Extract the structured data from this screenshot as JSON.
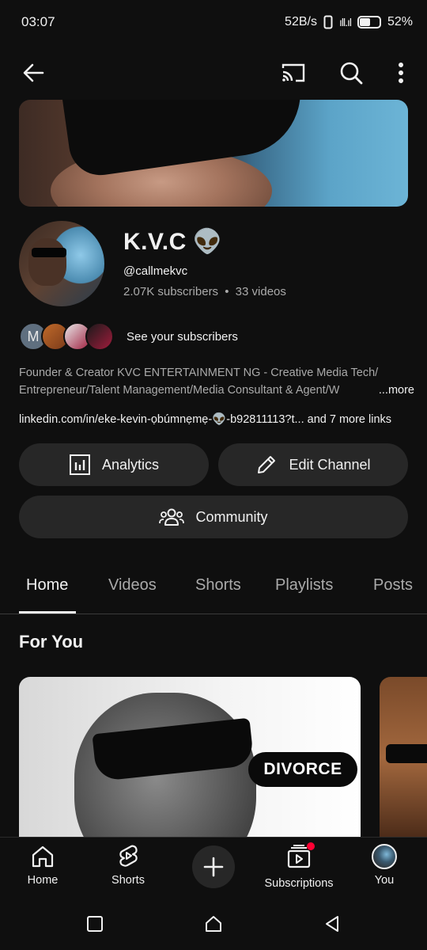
{
  "status_bar": {
    "time": "03:07",
    "net_speed": "52B/s",
    "signal": "ıll.ıl",
    "battery": "52%"
  },
  "channel": {
    "name": "K.V.C",
    "emoji": "👽",
    "handle": "@callmekvc",
    "subscribers": "2.07K subscribers",
    "separator": "•",
    "videos": "33 videos",
    "see_subscribers": "See your subscribers",
    "subscriber_initial": "M",
    "description_line1": "Founder & Creator KVC ENTERTAINMENT NG - Creative Media Tech/",
    "description_line2": "Entrepreneur/Talent Management/Media Consultant & Agent/W",
    "more": "...more",
    "link_text": "linkedin.com/in/eke-kevin-ọbúmnẹmẹ-👽-b92811113?t...",
    "more_links": "and 7 more links"
  },
  "buttons": {
    "analytics": "Analytics",
    "edit_channel": "Edit Channel",
    "community": "Community"
  },
  "tabs": [
    {
      "label": "Home",
      "active": true
    },
    {
      "label": "Videos",
      "active": false
    },
    {
      "label": "Shorts",
      "active": false
    },
    {
      "label": "Playlists",
      "active": false
    },
    {
      "label": "Posts",
      "active": false
    }
  ],
  "section": {
    "title": "For You",
    "thumb_badge": "DIVORCE"
  },
  "bottom_nav": {
    "home": "Home",
    "shorts": "Shorts",
    "subscriptions": "Subscriptions",
    "you": "You"
  },
  "colors": {
    "background": "#0f0f0f",
    "button_bg": "#272727",
    "secondary_text": "#aaaaaa",
    "notification_dot": "#ff0033"
  },
  "icons": {
    "back": "arrow-left-icon",
    "cast": "cast-icon",
    "search": "search-icon",
    "more": "more-vertical-icon",
    "analytics": "bar-chart-icon",
    "edit": "pencil-icon",
    "community": "people-icon"
  }
}
